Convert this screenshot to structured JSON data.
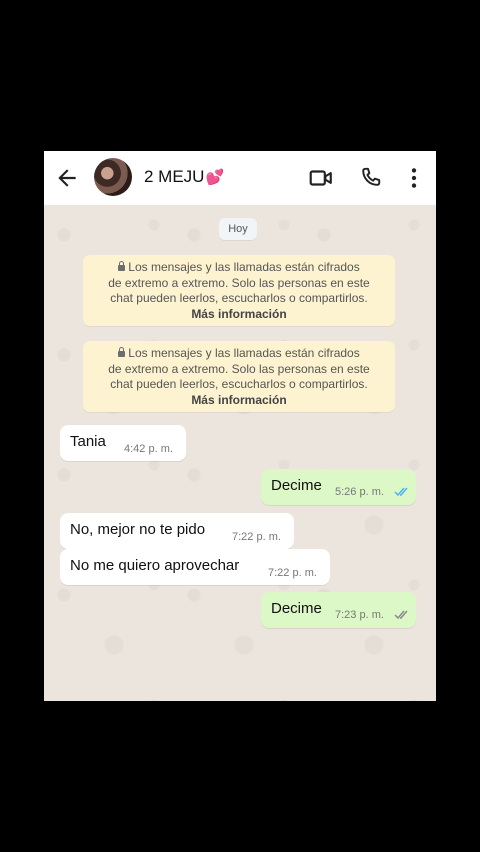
{
  "header": {
    "contact_name": "2 MEJU",
    "name_emoji": "💕"
  },
  "chat": {
    "date_chip": "Hoy",
    "notices": [
      {
        "line1": "Los mensajes y las llamadas están cifrados",
        "line2": "de extremo a extremo. Solo las personas en este",
        "line3": "chat pueden leerlos, escucharlos o compartirlos.",
        "more": "Más información"
      },
      {
        "line1": "Los mensajes y las llamadas están cifrados",
        "line2": "de extremo a extremo. Solo las personas en este",
        "line3": "chat pueden leerlos, escucharlos o compartirlos.",
        "more": "Más información"
      }
    ],
    "messages": [
      {
        "direction": "in",
        "text": "Tania",
        "time": "4:42 p. m."
      },
      {
        "direction": "out",
        "text": "Decime",
        "time": "5:26 p. m.",
        "status": "read"
      },
      {
        "direction": "in",
        "text": "No, mejor no te pido",
        "time": "7:22 p. m."
      },
      {
        "direction": "in",
        "text": "No me quiero aprovechar",
        "time": "7:22 p. m."
      },
      {
        "direction": "out",
        "text": "Decime",
        "time": "7:23 p. m.",
        "status": "delivered"
      }
    ]
  },
  "colors": {
    "outgoing_bubble": "#dcf8c6",
    "incoming_bubble": "#ffffff",
    "chat_background": "#ece5dd",
    "notice_background": "#fdf3d0",
    "read_ticks": "#4fb3f0",
    "delivered_ticks": "#8a8a8a"
  },
  "icons": [
    "back-arrow-icon",
    "video-call-icon",
    "phone-icon",
    "more-options-icon",
    "lock-icon",
    "double-check-icon"
  ]
}
